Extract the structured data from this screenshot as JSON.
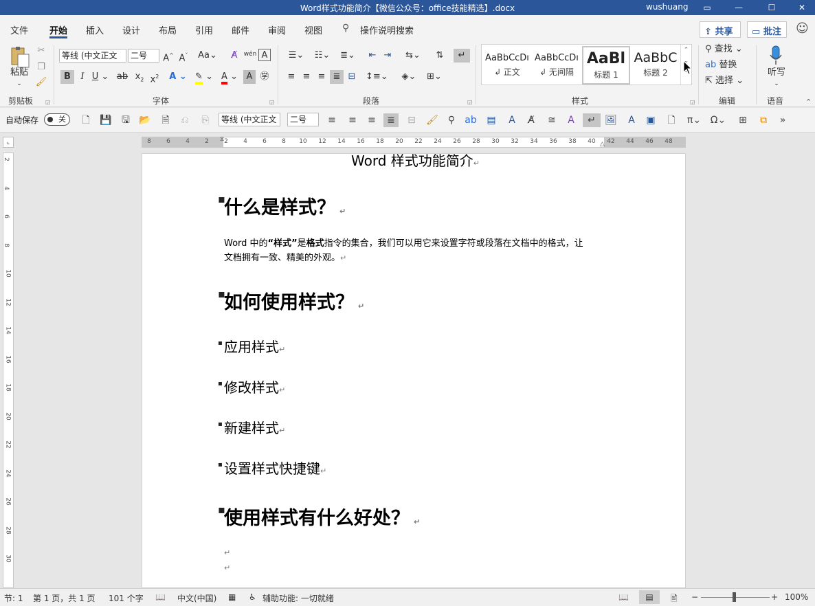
{
  "window": {
    "title": "Word样式功能简介【微信公众号：office技能精选】.docx",
    "user": "wushuang"
  },
  "tabs": [
    "文件",
    "开始",
    "插入",
    "设计",
    "布局",
    "引用",
    "邮件",
    "审阅",
    "视图"
  ],
  "tell_me": "操作说明搜索",
  "share_label": "共享",
  "comments_label": "批注",
  "ribbon": {
    "clipboard": {
      "paste": "粘贴",
      "group": "剪贴板"
    },
    "font": {
      "name": "等线 (中文正文",
      "size": "二号",
      "group": "字体",
      "grow": "A^",
      "shrink": "A˅",
      "case": "Aa",
      "phonetic": "wén",
      "bold": "B",
      "italic": "I",
      "underline": "U",
      "strike": "ab",
      "sub": "x₂",
      "sup": "x²"
    },
    "paragraph": {
      "group": "段落"
    },
    "styles": {
      "group": "样式",
      "items": [
        {
          "preview": "AaBbCcDı",
          "name": "↲ 正文"
        },
        {
          "preview": "AaBbCcDı",
          "name": "↲ 无间隔"
        },
        {
          "preview": "AaBl",
          "name": "标题 1"
        },
        {
          "preview": "AaBbC",
          "name": "标题 2"
        }
      ]
    },
    "editing": {
      "group": "编辑",
      "find": "查找",
      "replace": "替换",
      "select": "选择"
    },
    "voice": {
      "group": "语音",
      "dictate": "听写"
    }
  },
  "qat": {
    "autosave": "自动保存",
    "toggle": "关",
    "font": "等线 (中文正文",
    "size": "二号"
  },
  "colors": {
    "accent": "#2b579a",
    "highlight": "#ffff00",
    "font_color": "#ff0000"
  },
  "ruler": {
    "h": [
      "8",
      "6",
      "4",
      "2",
      "2",
      "4",
      "6",
      "8",
      "10",
      "12",
      "14",
      "16",
      "18",
      "20",
      "22",
      "24",
      "26",
      "28",
      "30",
      "32",
      "34",
      "36",
      "38",
      "40",
      "42",
      "44",
      "46",
      "48"
    ],
    "v": [
      "2",
      "4",
      "6",
      "8",
      "10",
      "12",
      "14",
      "16",
      "18",
      "20",
      "22",
      "24",
      "26",
      "28",
      "30"
    ]
  },
  "doc": {
    "title": "Word 样式功能简介",
    "h1_a": "什么是样式？",
    "p1_a": "Word 中的",
    "p1_b": "“样式”",
    "p1_c": "是",
    "p1_d": "格式",
    "p1_e": "指令的集合，我们可以用它来设置字符或段落在文档中的格式，让",
    "p1_f": "文档拥有一致、精美的外观。",
    "h1_b": "如何使用样式？",
    "items": [
      "应用样式",
      "修改样式",
      "新建样式",
      "设置样式快捷键"
    ],
    "h1_c": "使用样式有什么好处？",
    "para_mark": "↵"
  },
  "status": {
    "section": "节: 1",
    "page": "第 1 页，共 1 页",
    "words": "101 个字",
    "lang": "中文(中国)",
    "accessibility": "辅助功能: 一切就绪",
    "zoom": "100%"
  }
}
